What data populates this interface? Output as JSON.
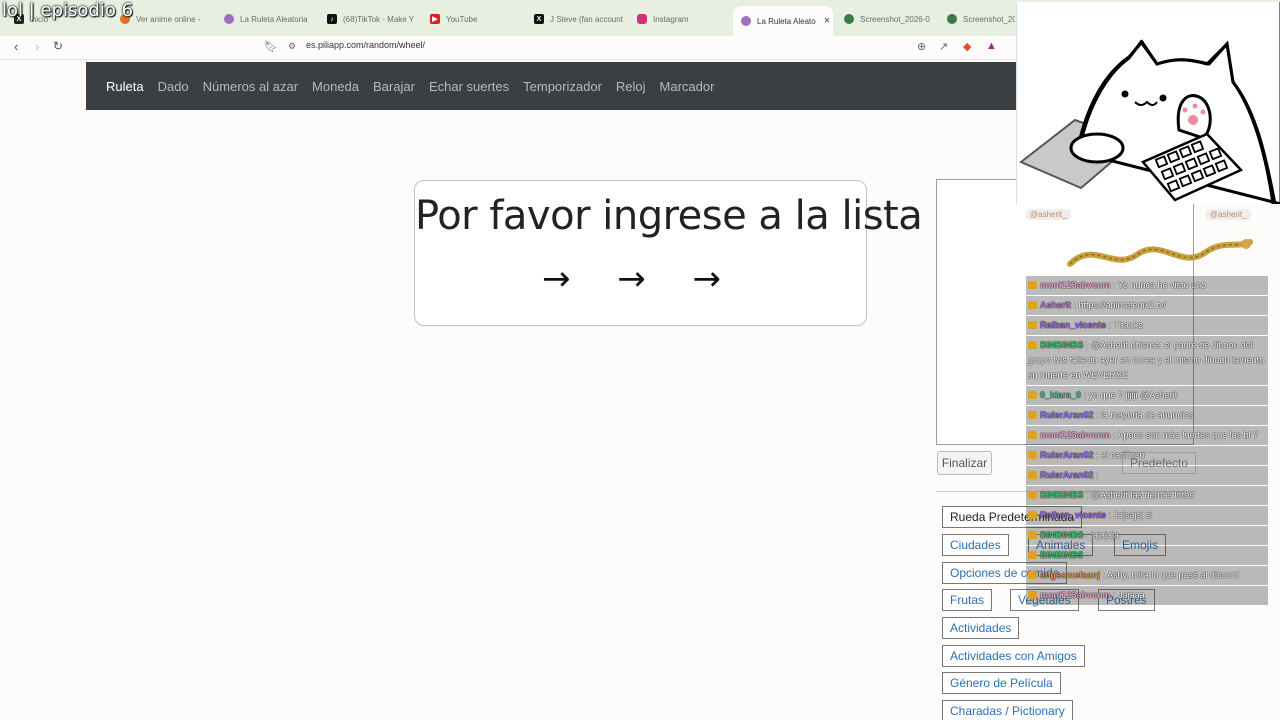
{
  "overlay": {
    "title": "lol | episodio 6"
  },
  "tabs": [
    {
      "label": "inicio",
      "color": "#222"
    },
    {
      "label": "Ver anime online -",
      "color": "#e07020"
    },
    {
      "label": "La Ruleta Aleatoria",
      "color": "#a070c0"
    },
    {
      "label": "(68)TikTok - Make Y",
      "color": "#111"
    },
    {
      "label": "YouTube",
      "color": "#e02020"
    },
    {
      "label": "J Steve (fan account",
      "color": "#111"
    },
    {
      "label": "Instagram",
      "color": "#d03080"
    },
    {
      "label": "La Ruleta Aleato",
      "color": "#a070c0"
    },
    {
      "label": "Screenshot_2026-0",
      "color": "#3a7a4a"
    },
    {
      "label": "Screenshot_202",
      "color": "#3a7a4a"
    }
  ],
  "toolbar": {
    "url": "es.piliapp.com/random/wheel/"
  },
  "nav": {
    "items": [
      "Ruleta",
      "Dado",
      "Números al azar",
      "Moneda",
      "Barajar",
      "Echar suertes",
      "Temporizador",
      "Reloj",
      "Marcador"
    ]
  },
  "card": {
    "title": "Por favor ingrese a la lista",
    "arrows": "→ → →"
  },
  "panel": {
    "finalizar": "Finalizar",
    "presets": [
      "Rueda Predeterminada",
      "Ciudades",
      "Animales",
      "Emojis",
      "Opciones de comida",
      "Frutas",
      "Vegetales",
      "Postres",
      "Actividades",
      "Actividades con Amigos",
      "Género de Película",
      "Charadas / Pictionary"
    ],
    "predefecto": "Predefecto"
  },
  "chat": {
    "handles": [
      "@asherit_",
      "@asherit_"
    ],
    "messages": [
      {
        "user": "moni123abvcnm",
        "color": "#e8a0c8",
        "text": ": Yo nunca he visto uno"
      },
      {
        "user": "Asherit",
        "color": "#c070e0",
        "text": ": https://animefenix2.tv/"
      },
      {
        "user": "Raiban_vicente",
        "color": "#a060f0",
        "text": ": Thanks"
      },
      {
        "user": "BINBINBS",
        "color": "#40c070",
        "text": ": @Asherit chisme: el padre de Jihoon del grupo tws fallecio ayer en corea y el mismo Jihoon lamento su muerte en WEVERSE"
      },
      {
        "user": "0_kiara_0",
        "color": "#40c0a0",
        "text": ": yo que ? jijiji @Asherit"
      },
      {
        "user": "RulerAran02",
        "color": "#9070f0",
        "text": ": la mayoria de anuncios"
      },
      {
        "user": "moni123abvcnm",
        "color": "#e8a0c8",
        "text": ": Apoco son más fuertes que los bl ?"
      },
      {
        "user": "RulerAran02",
        "color": "#9070f0",
        "text": ": el cariñoso"
      },
      {
        "user": "RulerAran02",
        "color": "#9070f0",
        "text": ":"
      },
      {
        "user": "BINBINBS",
        "color": "#40c070",
        "text": ": @Asherit las demás fotos"
      },
      {
        "user": "Raiban_vicente",
        "color": "#a060f0",
        "text": ": Jajsajsj si"
      },
      {
        "user": "BINBINBS",
        "color": "#40c070",
        "text": ": jajajaja"
      },
      {
        "user": "BINBINBS",
        "color": "#40c070",
        "text": ":"
      },
      {
        "user": "angesmefaanj",
        "color": "#e0a040",
        "text": ": Ashy, mira lo que pasé al discord"
      },
      {
        "user": "moni123abvcnm",
        "color": "#e8a0c8",
        "text": ": Jajaaa"
      }
    ]
  }
}
